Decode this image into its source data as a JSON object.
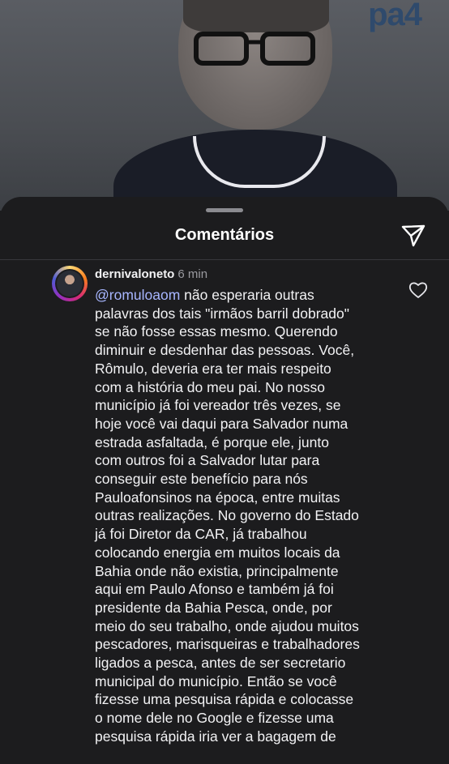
{
  "media": {
    "logo_text": "pa4"
  },
  "sheet": {
    "title": "Comentários",
    "share_icon": "paper-plane-icon"
  },
  "comment": {
    "username": "dernivaloneto",
    "time": "6 min",
    "mention": "@romuloaom",
    "text": " não esperaria outras\npalavras dos tais \"irmãos barril dobrado\"\nse não fosse essas mesmo. Querendo\ndiminuir e desdenhar das pessoas. Você,\nRômulo, deveria era ter mais respeito\ncom a história do meu pai. No nosso\nmunicípio já foi vereador três vezes, se\nhoje você vai daqui para Salvador numa\nestrada asfaltada, é porque ele, junto\ncom outros foi a Salvador lutar para\nconseguir este benefício para nós\nPauloafonsinos na época, entre muitas\noutras realizações. No governo do Estado\njá foi Diretor da CAR, já trabalhou\ncolocando energia em muitos locais da\nBahia onde não existia, principalmente\naqui em Paulo Afonso e também já foi\npresidente da Bahia Pesca, onde, por\nmeio do seu trabalho, onde ajudou muitos\npescadores, marisqueiras e trabalhadores\nligados a pesca, antes de ser secretario\nmunicipal do município. Então se você\nfizesse uma pesquisa rápida e colocasse\no nome dele no Google e fizesse uma\npesquisa rápida iria ver a bagagem de",
    "like_icon": "heart-outline-icon"
  },
  "colors": {
    "background": "#1c1c1e",
    "mention": "#a7b6ff",
    "text": "#f2f2f4",
    "muted": "#9a9aa0"
  }
}
